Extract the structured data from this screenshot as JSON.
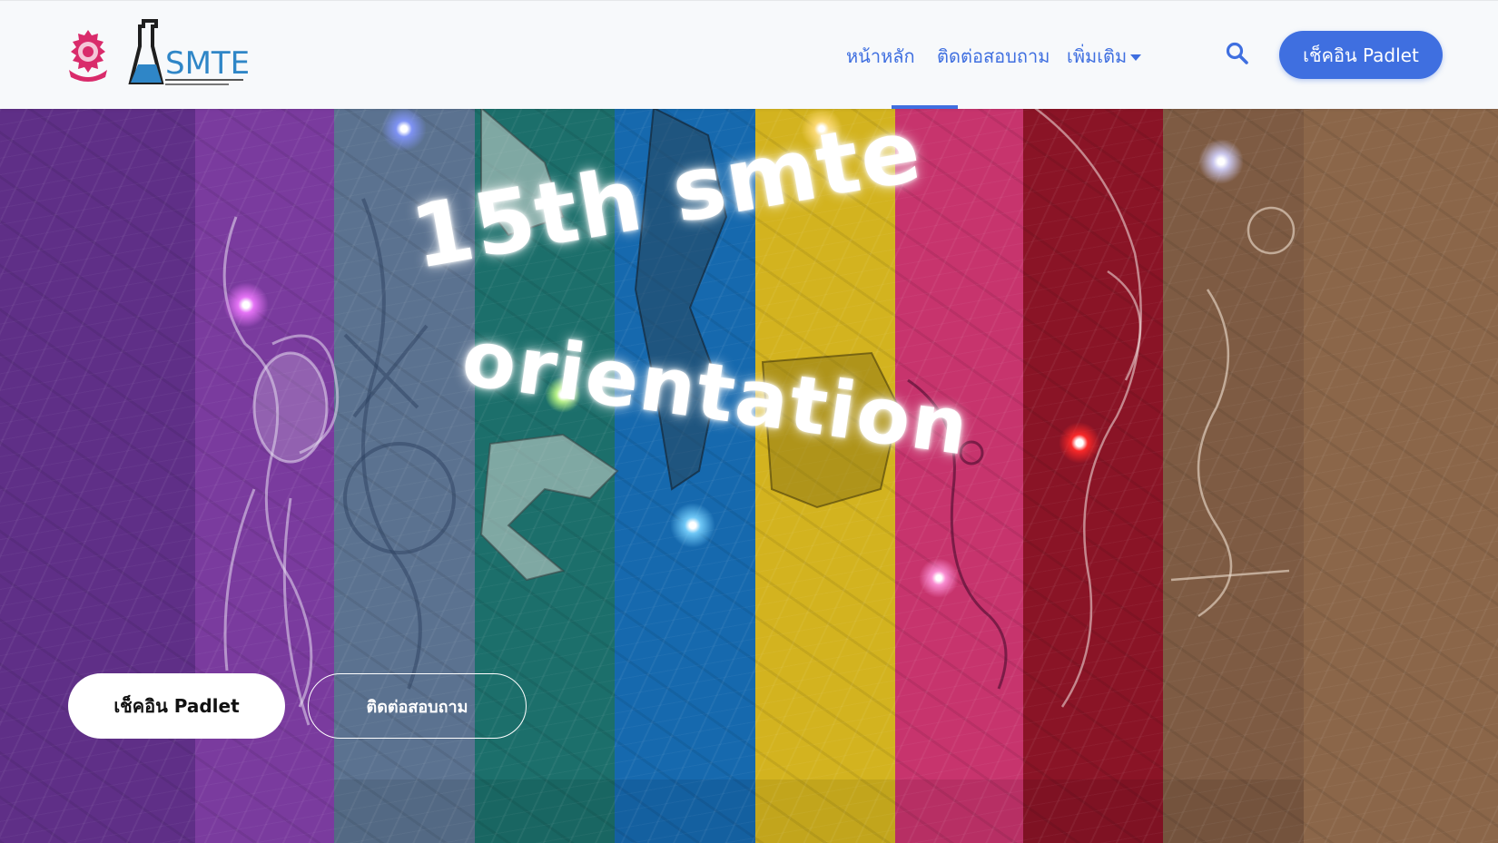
{
  "navbar": {
    "logo_text": "SMTE",
    "links": [
      {
        "label": "หน้าหลัก",
        "active": true
      },
      {
        "label": "ติดต่อสอบถาม",
        "active": false
      },
      {
        "label": "เพิ่มเติม",
        "active": false
      }
    ],
    "search_icon": "search-icon",
    "cta_label": "เช็คอิน Padlet"
  },
  "hero": {
    "title_line1": "15th smte",
    "title_line2": "orientation",
    "primary_button": "เช็คอิน Padlet",
    "secondary_button": "ติดต่อสอบถาม",
    "stripe_colors": [
      "#5e2f86",
      "#7b3c9e",
      "#5d7390",
      "#1e6e6a",
      "#1569ad",
      "#d4b520",
      "#c8356e",
      "#8b1425",
      "#7d5a42",
      "#8a6548"
    ]
  },
  "colors": {
    "accent": "#3f6fe0",
    "navbar_bg": "#f7f9fb"
  }
}
